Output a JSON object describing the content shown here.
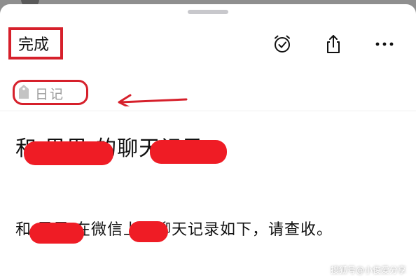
{
  "toolbar": {
    "done_label": "完成",
    "icons": [
      "alarm-clock-icon",
      "share-icon",
      "more-icon"
    ]
  },
  "tag": {
    "label": "日记",
    "icon": "tag-icon"
  },
  "note": {
    "title": " 和  果果 的聊天记录",
    "body": " 和  果果 在微信上的聊天记录如下，请查收。"
  },
  "watermark": "搜狐号@小俊爱分享",
  "colors": {
    "annotation_red": "#d6202b",
    "redaction_red": "#ef1c25",
    "tag_gray": "#9b9b9b"
  }
}
